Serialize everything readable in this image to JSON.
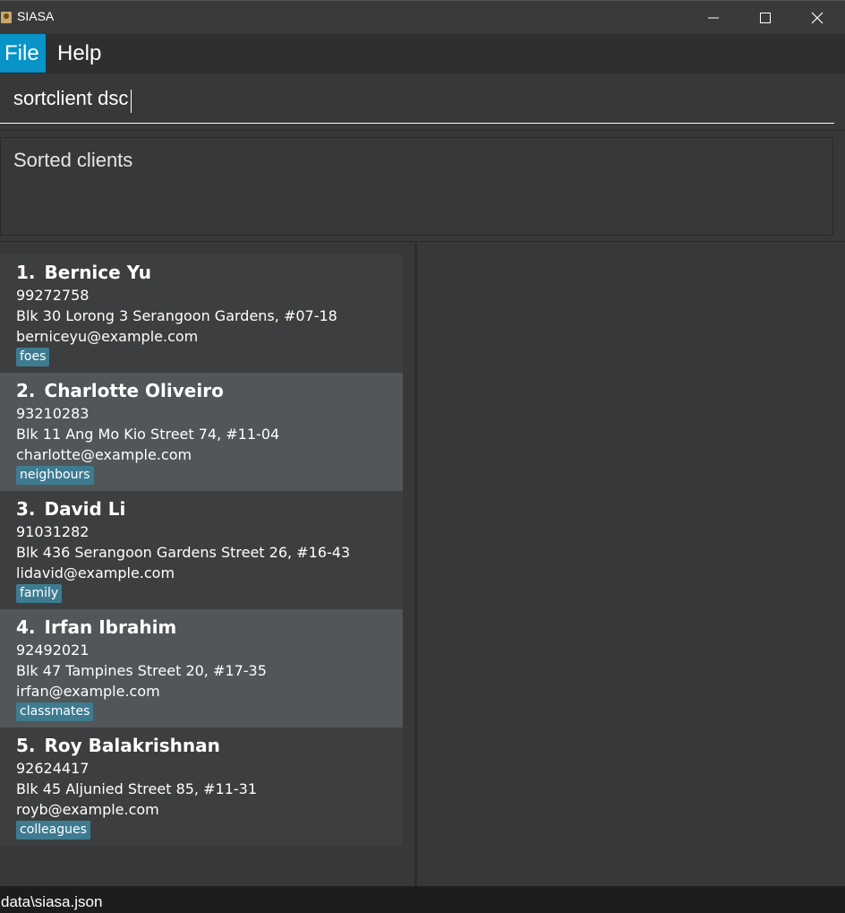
{
  "window": {
    "title": "SIASA",
    "app_icon": "person-card-icon",
    "controls": [
      "minimize-icon",
      "maximize-icon",
      "close-icon"
    ]
  },
  "menu": {
    "items": [
      {
        "label": "File"
      },
      {
        "label": "Help"
      }
    ]
  },
  "command": {
    "value": "sortclient dsc"
  },
  "result": {
    "message": "Sorted clients"
  },
  "clients": [
    {
      "index": "1.",
      "name": "Bernice Yu",
      "phone": "99272758",
      "address": "Blk 30 Lorong 3 Serangoon Gardens, #07-18",
      "email": "berniceyu@example.com",
      "tag": "foes"
    },
    {
      "index": "2.",
      "name": "Charlotte Oliveiro",
      "phone": "93210283",
      "address": "Blk 11 Ang Mo Kio Street 74, #11-04",
      "email": "charlotte@example.com",
      "tag": "neighbours"
    },
    {
      "index": "3.",
      "name": "David Li",
      "phone": "91031282",
      "address": "Blk 436 Serangoon Gardens Street 26, #16-43",
      "email": "lidavid@example.com",
      "tag": "family"
    },
    {
      "index": "4.",
      "name": "Irfan Ibrahim",
      "phone": "92492021",
      "address": "Blk 47 Tampines Street 20, #17-35",
      "email": "irfan@example.com",
      "tag": "classmates"
    },
    {
      "index": "5.",
      "name": "Roy Balakrishnan",
      "phone": "92624417",
      "address": "Blk 45 Aljunied Street 85, #11-31",
      "email": "royb@example.com",
      "tag": "colleagues"
    }
  ],
  "status": {
    "path": "data\\siasa.json"
  },
  "colors": {
    "accent": "#0893c9",
    "tag": "#3e7b91",
    "card": "#3c3e3f",
    "card_alt": "#515658"
  }
}
